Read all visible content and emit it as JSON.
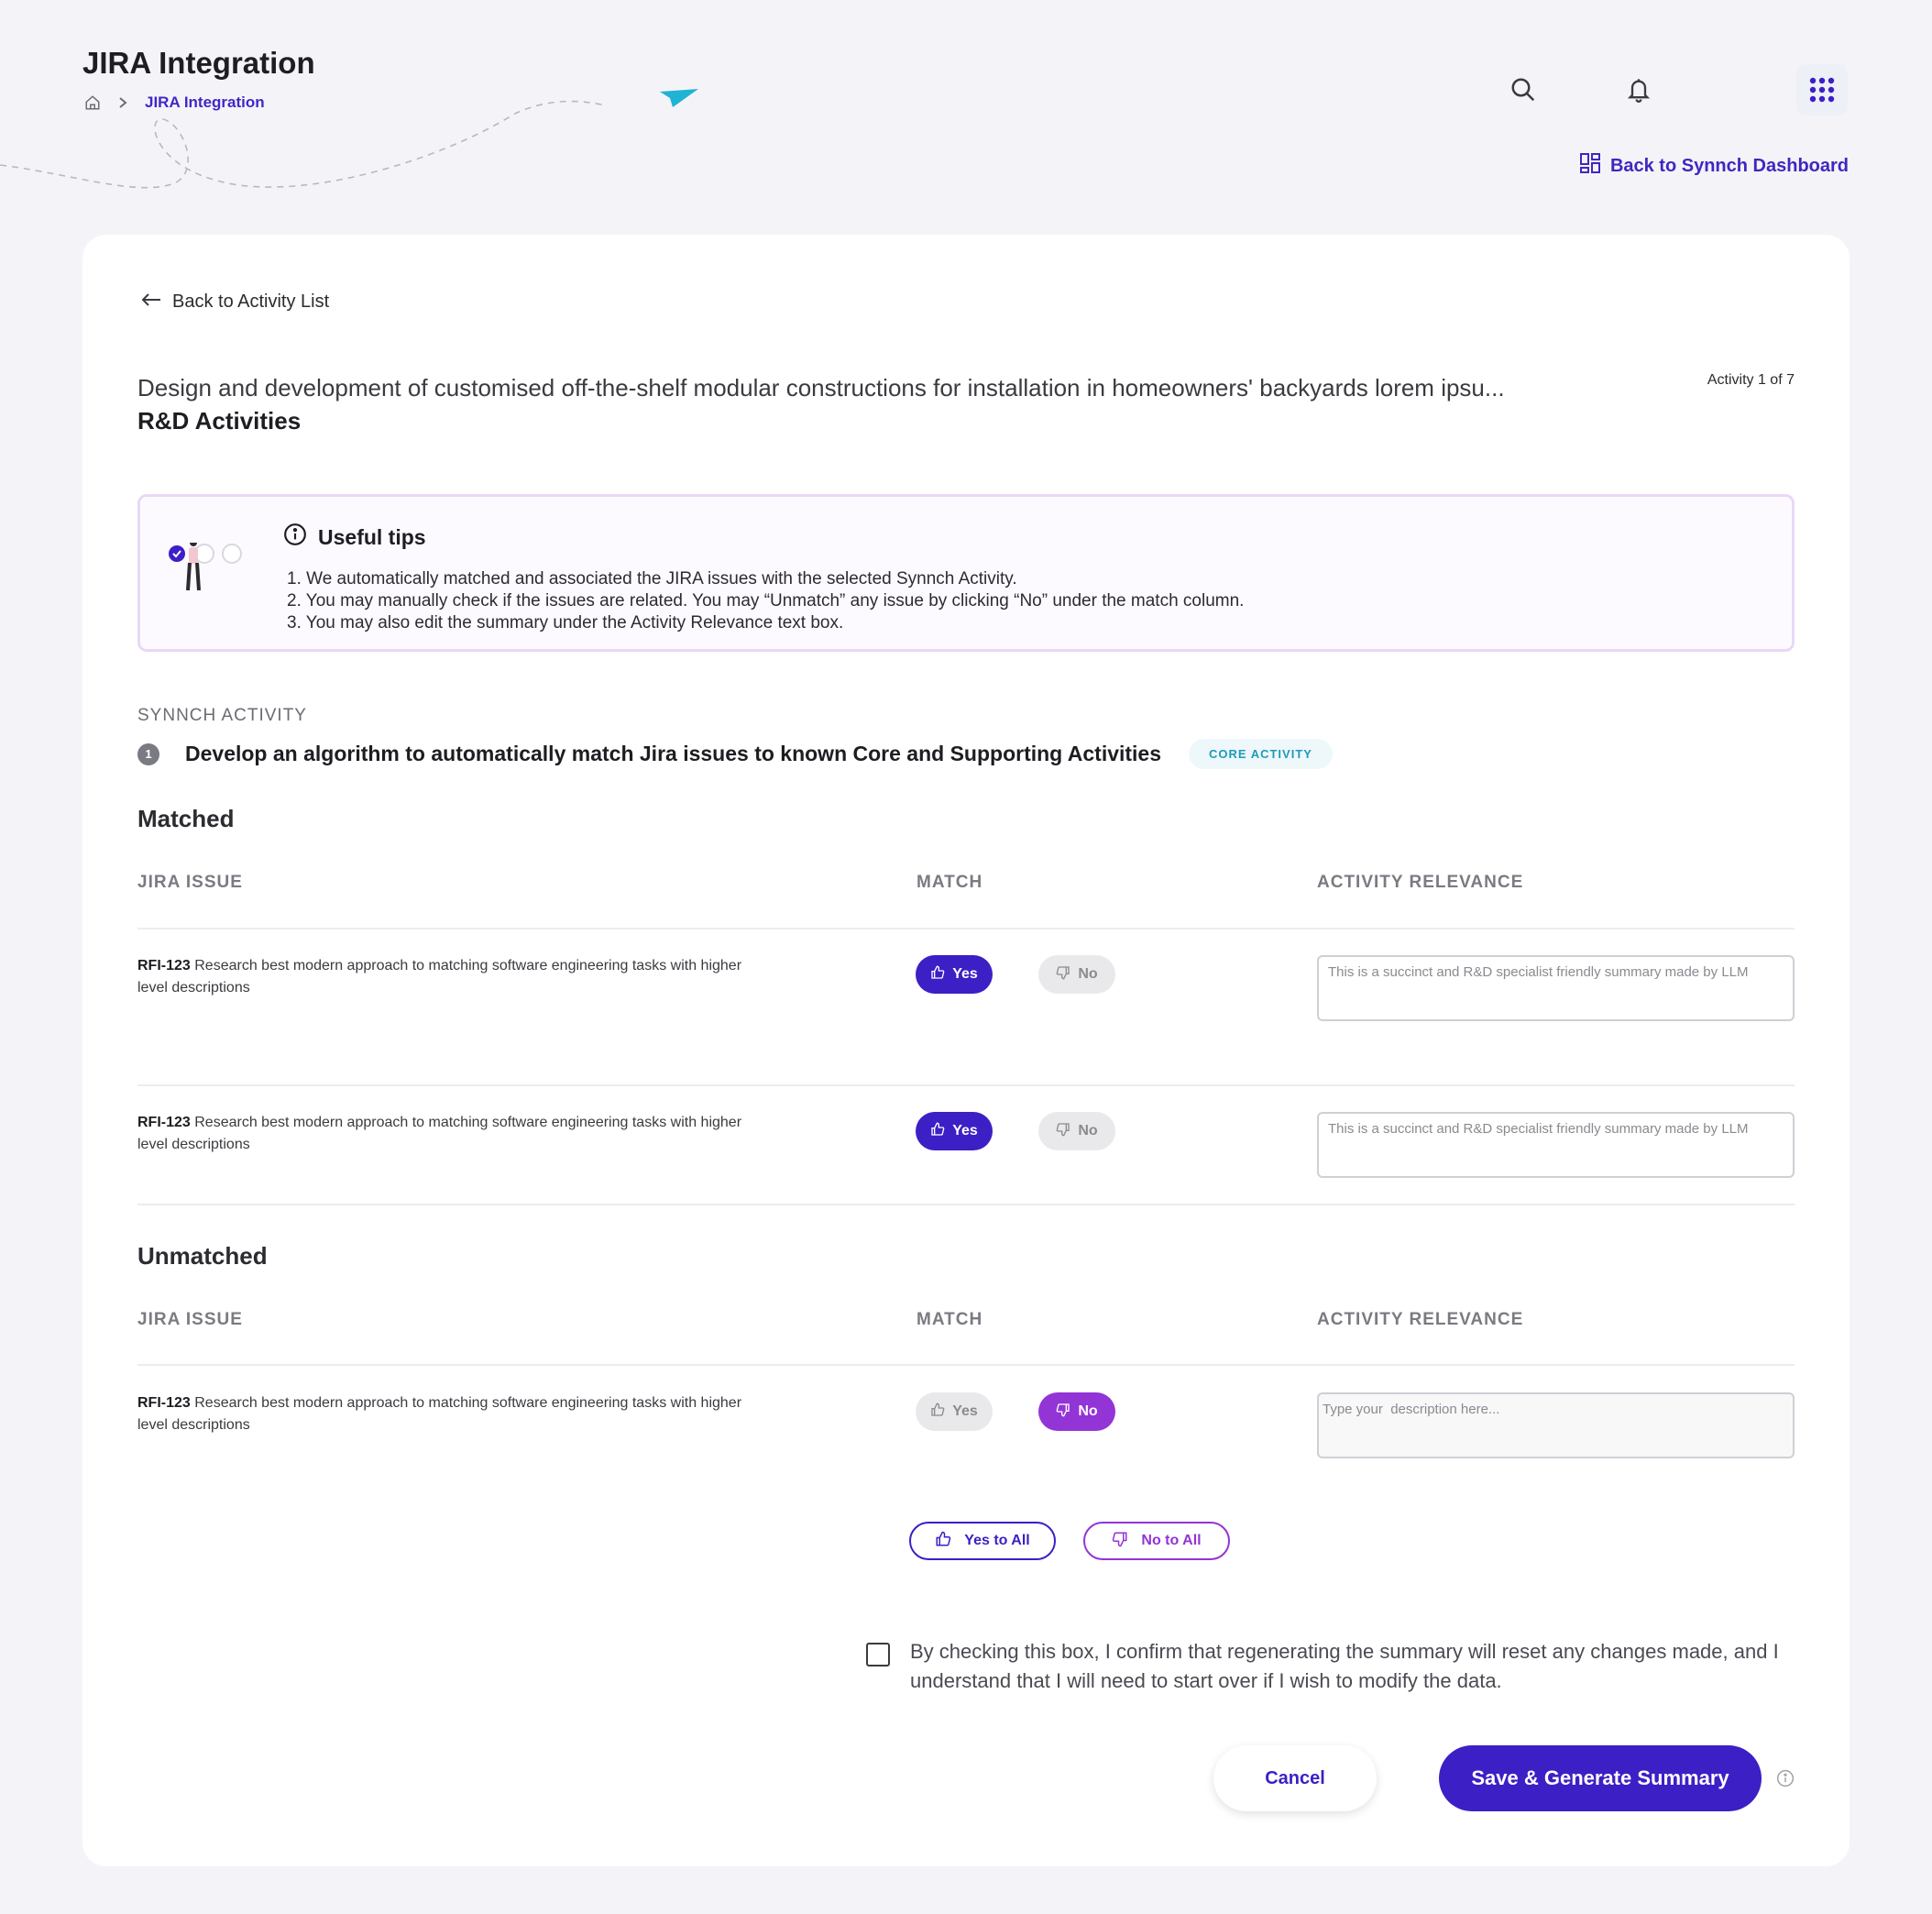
{
  "header": {
    "title": "JIRA Integration",
    "breadcrumb_current": "JIRA Integration",
    "back_dashboard": "Back to Synnch Dashboard"
  },
  "card": {
    "back_list": "Back to Activity List",
    "activity_description": "Design and development of customised off-the-shelf modular constructions for installation in homeowners' backyards lorem ipsu...",
    "activity_category": "R&D Activities",
    "activity_count": "Activity 1 of 7"
  },
  "tips": {
    "title": "Useful tips",
    "items": [
      "1. We automatically matched and associated the JIRA issues with the selected Synnch Activity.",
      "2. You may manually check if the issues are related. You may “Unmatch” any issue by clicking “No” under the match column.",
      "3. You may also edit the summary under the Activity Relevance text box."
    ]
  },
  "synch": {
    "label": "SYNNCH ACTIVITY",
    "number": "1",
    "title": "Develop an algorithm to automatically match Jira issues to known Core and Supporting Activities",
    "badge": "CORE ACTIVITY"
  },
  "columns": {
    "issue": "JIRA ISSUE",
    "match": "MATCH",
    "relevance": "ACTIVITY RELEVANCE"
  },
  "matched": {
    "title": "Matched",
    "rows": [
      {
        "key": "RFI-123",
        "text": " Research best modern approach to matching software engineering tasks with higher level descriptions",
        "yes": "Yes",
        "no": "No",
        "relevance": "This is a succinct and R&D specialist friendly summary made by LLM"
      },
      {
        "key": "RFI-123",
        "text": " Research best modern approach to matching software engineering tasks with higher level descriptions",
        "yes": "Yes",
        "no": "No",
        "relevance": "This is a succinct and R&D specialist friendly summary made by LLM"
      }
    ]
  },
  "unmatched": {
    "title": "Unmatched",
    "rows": [
      {
        "key": "RFI-123",
        "text": " Research best modern approach to matching software engineering tasks with higher level descriptions",
        "yes": "Yes",
        "no": "No",
        "placeholder": "Type your  description here..."
      }
    ]
  },
  "bulk": {
    "yes_all": "Yes to All",
    "no_all": "No to All"
  },
  "confirm": {
    "text": "By checking this box, I confirm that regenerating the summary will reset any changes made, and I understand that I will need to start over if I wish to modify the data."
  },
  "actions": {
    "cancel": "Cancel",
    "save": "Save & Generate Summary"
  },
  "colors": {
    "primary": "#3d1fc6",
    "no_active": "#9334d6",
    "core_badge": "#1f9ab8",
    "paper_plane": "#1fb3d6"
  }
}
